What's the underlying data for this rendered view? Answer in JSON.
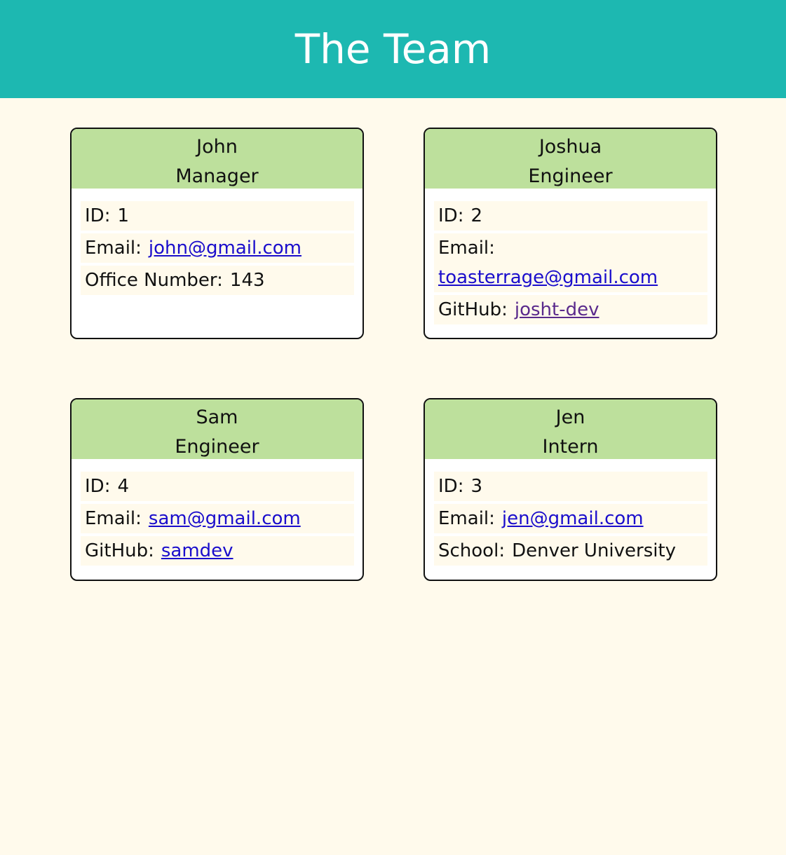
{
  "header": {
    "title": "The Team"
  },
  "cards": [
    {
      "name": "John",
      "role": "Manager",
      "id_label": "ID:",
      "id": "1",
      "email_label": "Email:",
      "email": "john@gmail.com",
      "extra_label": "Office Number:",
      "extra": "143"
    },
    {
      "name": "Joshua",
      "role": "Engineer",
      "id_label": "ID:",
      "id": "2",
      "email_label": "Email:",
      "email": "toasterrage@gmail.com",
      "extra_label": "GitHub:",
      "extra": "josht-dev"
    },
    {
      "name": "Sam",
      "role": "Engineer",
      "id_label": "ID:",
      "id": "4",
      "email_label": "Email:",
      "email": "sam@gmail.com",
      "extra_label": "GitHub:",
      "extra": "samdev"
    },
    {
      "name": "Jen",
      "role": "Intern",
      "id_label": "ID:",
      "id": "3",
      "email_label": "Email:",
      "email": "jen@gmail.com",
      "extra_label": "School:",
      "extra": "Denver University"
    }
  ],
  "colors": {
    "header_bg": "#1db8b1",
    "page_bg": "#fffaec",
    "card_head_bg": "#bde09c",
    "link": "#1a0dcc",
    "visited_link": "#5a2a8c"
  }
}
